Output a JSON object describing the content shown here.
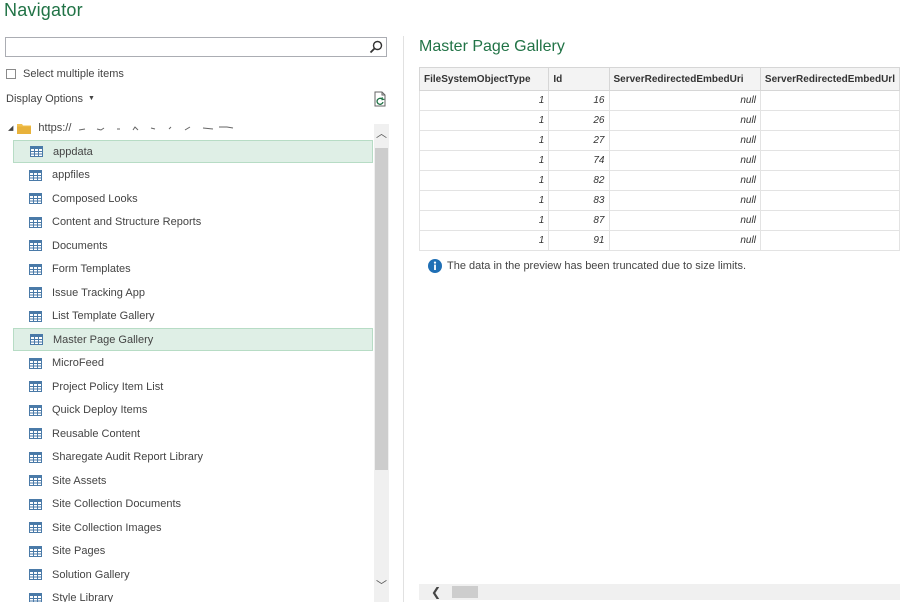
{
  "window": {
    "title": "Navigator"
  },
  "search": {
    "value": "",
    "placeholder": ""
  },
  "select_multiple": {
    "label": "Select multiple items",
    "checked": false
  },
  "display_options": {
    "label": "Display Options"
  },
  "tree": {
    "root": {
      "label": "https://"
    },
    "items": [
      {
        "label": "appdata",
        "state": "hover"
      },
      {
        "label": "appfiles"
      },
      {
        "label": "Composed Looks"
      },
      {
        "label": "Content and Structure Reports"
      },
      {
        "label": "Documents"
      },
      {
        "label": "Form Templates"
      },
      {
        "label": "Issue Tracking App"
      },
      {
        "label": "List Template Gallery"
      },
      {
        "label": "Master Page Gallery",
        "state": "selected"
      },
      {
        "label": "MicroFeed"
      },
      {
        "label": "Project Policy Item List"
      },
      {
        "label": "Quick Deploy Items"
      },
      {
        "label": "Reusable Content"
      },
      {
        "label": "Sharegate Audit Report Library"
      },
      {
        "label": "Site Assets"
      },
      {
        "label": "Site Collection Documents"
      },
      {
        "label": "Site Collection Images"
      },
      {
        "label": "Site Pages"
      },
      {
        "label": "Solution Gallery"
      },
      {
        "label": "Style Library"
      }
    ]
  },
  "preview": {
    "title": "Master Page Gallery",
    "columns": [
      "FileSystemObjectType",
      "Id",
      "ServerRedirectedEmbedUri",
      "ServerRedirectedEmbedUrl"
    ],
    "rows": [
      [
        "1",
        "16",
        "null",
        ""
      ],
      [
        "1",
        "26",
        "null",
        ""
      ],
      [
        "1",
        "27",
        "null",
        ""
      ],
      [
        "1",
        "74",
        "null",
        ""
      ],
      [
        "1",
        "82",
        "null",
        ""
      ],
      [
        "1",
        "83",
        "null",
        ""
      ],
      [
        "1",
        "87",
        "null",
        ""
      ],
      [
        "1",
        "91",
        "null",
        ""
      ]
    ],
    "truncated_message": "The data in the preview has been truncated due to size limits."
  },
  "colors": {
    "accent": "#217346",
    "selected_bg": "#dfefe6",
    "info": "#1f6fb5"
  }
}
